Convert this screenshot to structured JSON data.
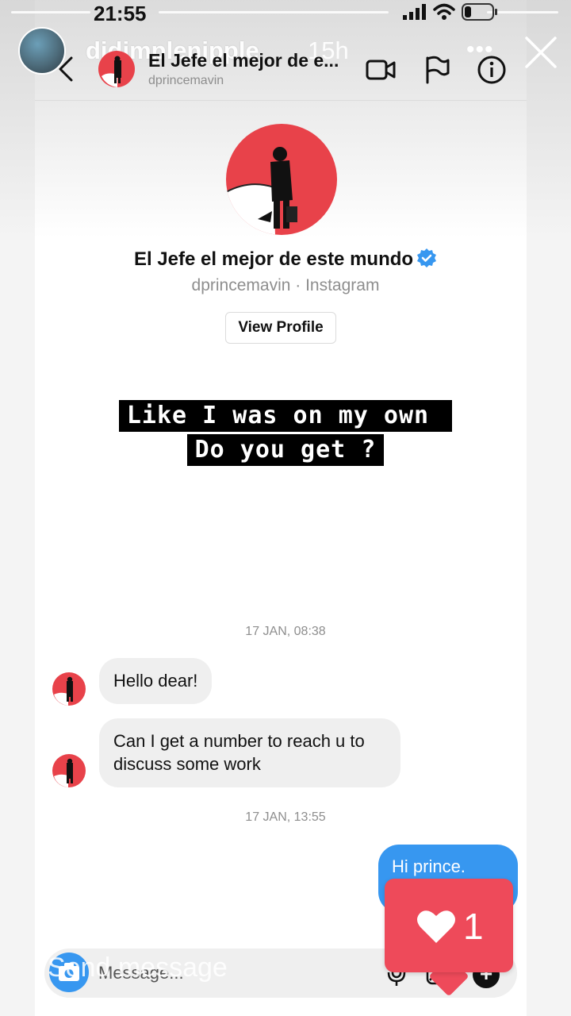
{
  "status_bar": {
    "time": "21:55"
  },
  "story": {
    "username": "djdimplenipple",
    "time_ago": "15h",
    "more": "•••"
  },
  "dm_header": {
    "title": "El Jefe el mejor de e...",
    "handle": "dprincemavin"
  },
  "profile": {
    "name": "El Jefe el mejor de este mundo",
    "subtitle": "dprincemavin · Instagram",
    "view_profile_label": "View Profile"
  },
  "caption": {
    "line1": "Like I was on my own ",
    "line2": "Do you get ?"
  },
  "chat": {
    "groups": [
      {
        "timestamp": "17 JAN, 08:38",
        "messages": [
          {
            "from": "them",
            "text": "Hello dear!"
          },
          {
            "from": "them",
            "text": "Can I get a number to reach u to discuss some work"
          }
        ]
      },
      {
        "timestamp": "17 JAN, 13:55",
        "messages": [
          {
            "from": "me",
            "text": "Hi prince."
          }
        ]
      }
    ]
  },
  "composer": {
    "placeholder": "Message...",
    "overlay_text": "Send message"
  },
  "like_popup": {
    "count": "1"
  },
  "colors": {
    "accent": "#3797f0",
    "like": "#ee4a5a",
    "avatar_red": "#e8424a"
  },
  "icons": [
    "close-icon",
    "back-chevron-icon",
    "video-call-icon",
    "flag-icon",
    "info-icon",
    "verified-badge-icon",
    "camera-icon",
    "mic-icon",
    "gallery-icon",
    "plus-icon",
    "heart-icon"
  ]
}
